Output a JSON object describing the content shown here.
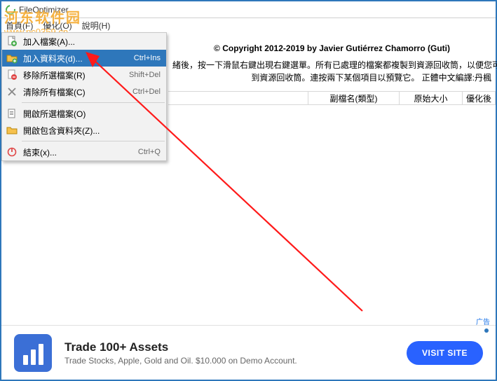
{
  "app": {
    "title": "FileOptimizer"
  },
  "menubar": {
    "items": [
      "首頁(F)",
      "優化(O)",
      "說明(H)"
    ]
  },
  "watermark": {
    "title": "河东软件园",
    "url": "www.pc0359.cn"
  },
  "dropdown": {
    "items": [
      {
        "label": "加入檔案(A)...",
        "shortcut": "",
        "icon": "file-add"
      },
      {
        "label": "加入資料夾(d)...",
        "shortcut": "Ctrl+Ins",
        "icon": "folder-add",
        "highlight": true
      },
      {
        "label": "移除所選檔案(R)",
        "shortcut": "Shift+Del",
        "icon": "file-remove"
      },
      {
        "label": "清除所有檔案(C)",
        "shortcut": "Ctrl+Del",
        "icon": "clear"
      },
      {
        "label": "開啟所選檔案(O)",
        "shortcut": "",
        "icon": "open-file"
      },
      {
        "label": "開啟包含資料夾(Z)...",
        "shortcut": "",
        "icon": "open-folder"
      },
      {
        "label": "結束(x)...",
        "shortcut": "Ctrl+Q",
        "icon": "power"
      }
    ]
  },
  "main": {
    "copyright": "© Copyright 2012-2019 by Javier Gutiérrez Chamorro (Guti)",
    "hint1": "緒後，按一下滑鼠右鍵出現右鍵選單。所有已處理的檔案都複製到資源回收筒，以便您可以輕",
    "hint2": "到資源回收筒。連按兩下某個項目以預覽它。                        正體中文編譯:丹楓"
  },
  "table": {
    "columns": [
      "",
      "副檔名(類型)",
      "原始大小",
      "優化後"
    ]
  },
  "ad": {
    "label": "广告",
    "title": "Trade 100+ Assets",
    "desc": "Trade Stocks, Apple, Gold and Oil. $10.000 on Demo Account.",
    "button": "VISIT SITE"
  }
}
